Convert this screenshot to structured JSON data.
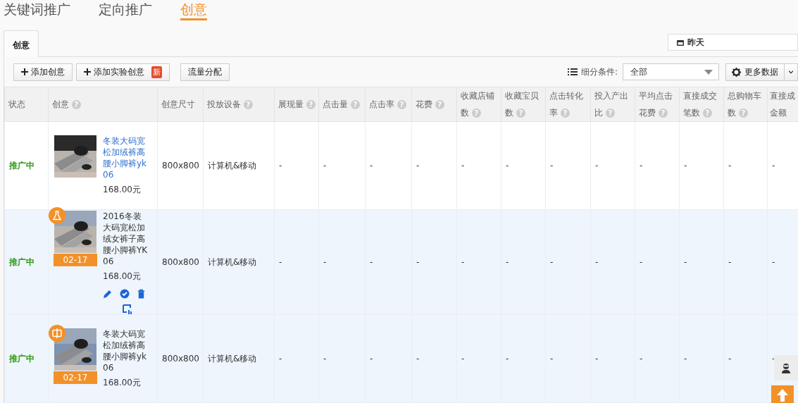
{
  "nav_tabs": [
    {
      "label": "关键词推广",
      "selected": false
    },
    {
      "label": "定向推广",
      "selected": false
    },
    {
      "label": "创意",
      "selected": true
    }
  ],
  "date_picker": {
    "value": "昨天"
  },
  "panel_tabs": [
    {
      "label": "创意",
      "selected": true
    }
  ],
  "toolbar": {
    "buttons": [
      {
        "label": "添加创意",
        "kind": "add"
      },
      {
        "label": "添加实验创意",
        "kind": "add",
        "badge": "新"
      },
      {
        "label": "流量分配",
        "kind": "plain"
      }
    ],
    "filter_label": "细分条件:",
    "filter_value": "全部",
    "more_button": "更多数据"
  },
  "table": {
    "columns": [
      {
        "lines": [
          "状态"
        ]
      },
      {
        "lines": [
          "创意"
        ],
        "help": "?"
      },
      {
        "lines": [
          "创意尺寸"
        ]
      },
      {
        "lines": [
          "投放设备"
        ],
        "help": "?"
      },
      {
        "lines": [
          "展现量"
        ],
        "help": "?"
      },
      {
        "lines": [
          "点击量"
        ],
        "help": "?"
      },
      {
        "lines": [
          "点击率"
        ],
        "help": "?"
      },
      {
        "lines": [
          "花费"
        ],
        "help": "?"
      },
      {
        "lines": [
          "收藏店铺",
          "数"
        ],
        "help": "?"
      },
      {
        "lines": [
          "收藏宝贝",
          "数"
        ],
        "help": "?"
      },
      {
        "lines": [
          "点击转化",
          "率"
        ],
        "help": "?"
      },
      {
        "lines": [
          "投入产出",
          "比"
        ],
        "help": "?"
      },
      {
        "lines": [
          "平均点击",
          "花费"
        ],
        "help": "?"
      },
      {
        "lines": [
          "直接成交",
          "笔数"
        ],
        "help": "?"
      },
      {
        "lines": [
          "总购物车",
          "数"
        ],
        "help": "?"
      },
      {
        "lines": [
          "直接成",
          "金额"
        ]
      }
    ],
    "rows": [
      {
        "status": "推广中",
        "highlighted": false,
        "kind": "plain",
        "title": "冬装大码宽松加绒裤高腰小脚裤yk06",
        "title_link": true,
        "price": "168.00元",
        "actions": false,
        "size": "800x800",
        "device": "计算机&移动",
        "metrics": [
          "-",
          "-",
          "-",
          "-",
          "-",
          "-",
          "-",
          "-",
          "-",
          "-",
          "-",
          "-"
        ]
      },
      {
        "status": "推广中",
        "highlighted": true,
        "kind": "flask",
        "date": "02-17",
        "title": "2016冬装大码宽松加绒女裤子高腰小脚裤YK06",
        "title_link": false,
        "price": "168.00元",
        "actions": true,
        "size": "800x800",
        "device": "计算机&移动",
        "metrics": [
          "-",
          "-",
          "-",
          "-",
          "-",
          "-",
          "-",
          "-",
          "-",
          "-",
          "-",
          "-"
        ]
      },
      {
        "status": "推广中",
        "highlighted": true,
        "kind": "split",
        "date": "02-17",
        "title": "冬装大码宽松加绒裤高腰小脚裤yk06",
        "title_link": false,
        "price": "168.00元",
        "actions": false,
        "size": "800x800",
        "device": "计算机&移动",
        "metrics": [
          "-",
          "-",
          "-",
          "-",
          "-",
          "-",
          "-",
          "-",
          "-",
          "-",
          "-",
          "-"
        ]
      }
    ]
  }
}
